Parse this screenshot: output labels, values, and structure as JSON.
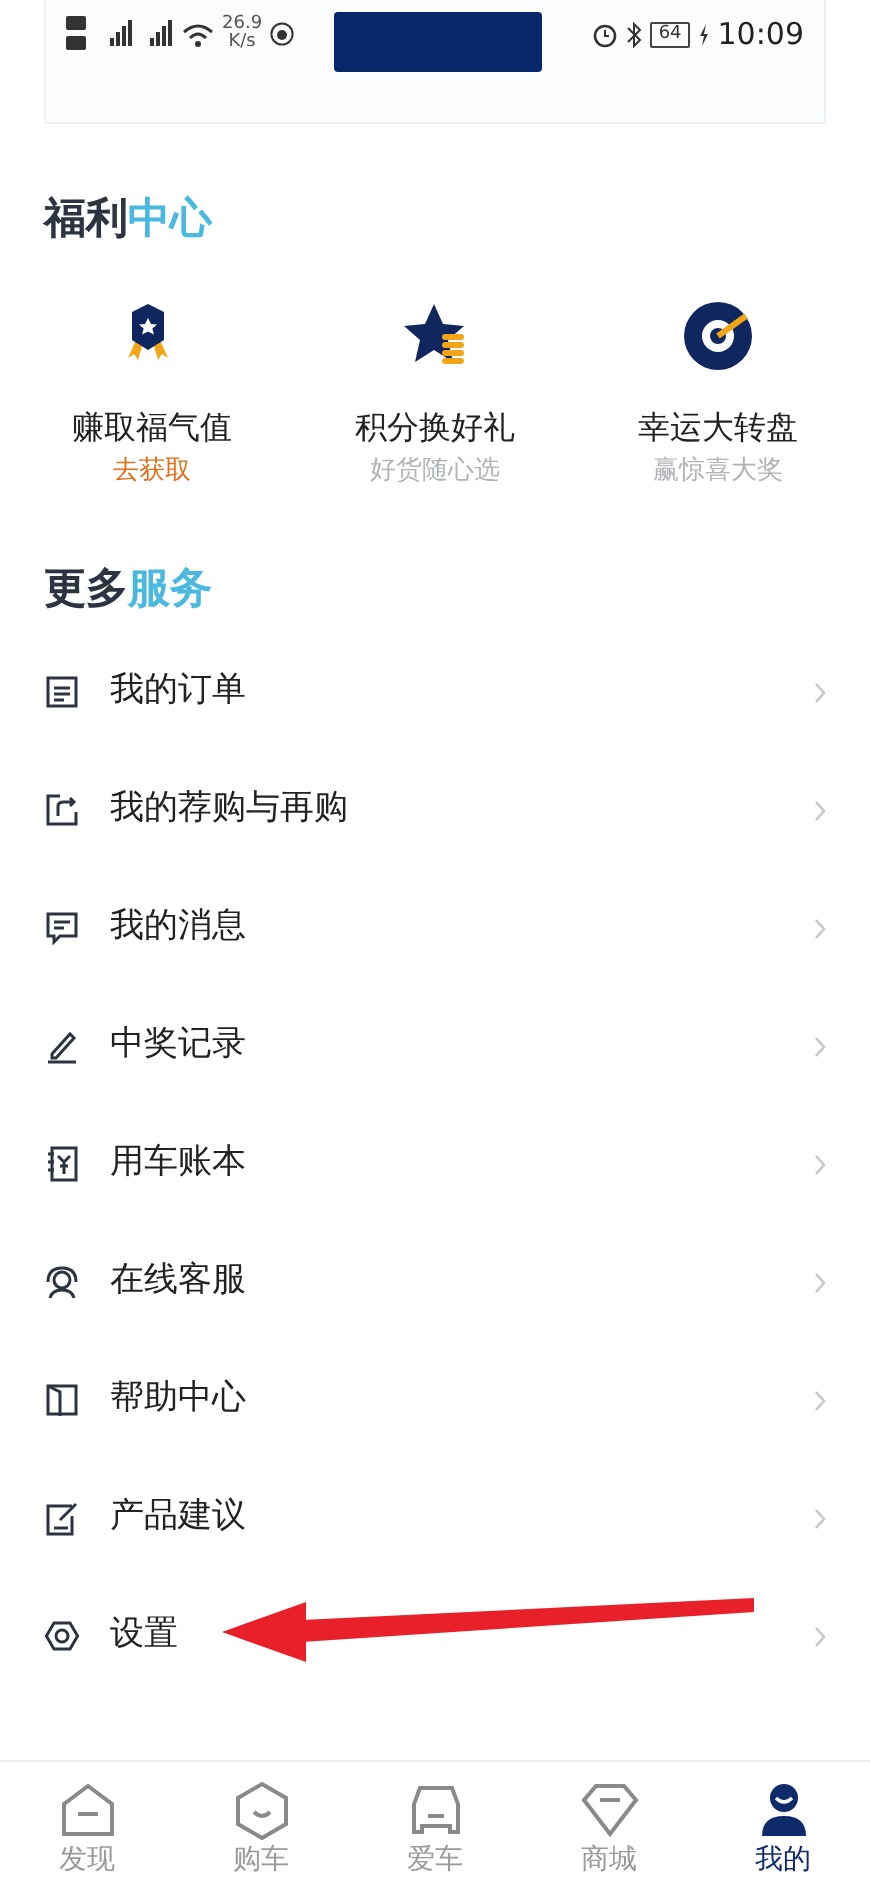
{
  "status_bar": {
    "speed": "26.9",
    "speed_unit": "K/s",
    "battery": "64",
    "time": "10:09"
  },
  "welfare": {
    "title": {
      "lead": "福利",
      "accent": "中心"
    },
    "items": [
      {
        "kind": "medal",
        "label": "赚取福气值",
        "sub": "去获取",
        "highlight": true
      },
      {
        "kind": "star",
        "label": "积分换好礼",
        "sub": "好货随心选",
        "highlight": false
      },
      {
        "kind": "target",
        "label": "幸运大转盘",
        "sub": "赢惊喜大奖",
        "highlight": false
      }
    ]
  },
  "services": {
    "title": {
      "lead": "更多",
      "accent": "服务"
    },
    "items": [
      {
        "kind": "order",
        "label": "我的订单",
        "arrow_pointed": false
      },
      {
        "kind": "rebuy",
        "label": "我的荐购与再购",
        "arrow_pointed": false
      },
      {
        "kind": "message",
        "label": "我的消息",
        "arrow_pointed": false
      },
      {
        "kind": "prize",
        "label": "中奖记录",
        "arrow_pointed": false
      },
      {
        "kind": "ledger",
        "label": "用车账本",
        "arrow_pointed": false
      },
      {
        "kind": "support",
        "label": "在线客服",
        "arrow_pointed": false
      },
      {
        "kind": "help",
        "label": "帮助中心",
        "arrow_pointed": false
      },
      {
        "kind": "suggest",
        "label": "产品建议",
        "arrow_pointed": false
      },
      {
        "kind": "settings",
        "label": "设置",
        "arrow_pointed": true
      }
    ]
  },
  "tab_bar": [
    {
      "kind": "discover",
      "label": "发现",
      "selected": false
    },
    {
      "kind": "buy",
      "label": "购车",
      "selected": false
    },
    {
      "kind": "car",
      "label": "爱车",
      "selected": false
    },
    {
      "kind": "mall",
      "label": "商城",
      "selected": false
    },
    {
      "kind": "me",
      "label": "我的",
      "selected": true
    }
  ],
  "annotation": {
    "kind": "arrow"
  }
}
